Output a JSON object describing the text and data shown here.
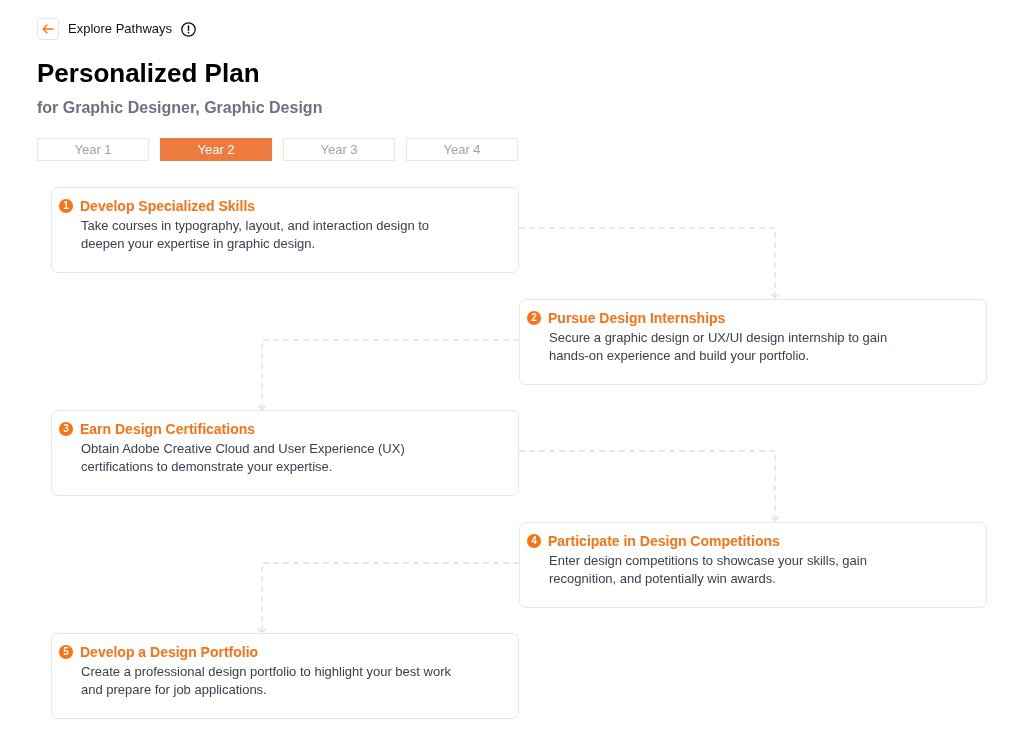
{
  "header": {
    "back_label": "Explore Pathways"
  },
  "title": "Personalized Plan",
  "subtitle": "for Graphic Designer, Graphic Design",
  "tabs": [
    {
      "label": "Year 1",
      "selected": false
    },
    {
      "label": "Year 2",
      "selected": true
    },
    {
      "label": "Year 3",
      "selected": false
    },
    {
      "label": "Year 4",
      "selected": false
    }
  ],
  "steps": [
    {
      "number": "1",
      "title": "Develop Specialized Skills",
      "description": "Take courses in typography, layout, and interaction design to deepen your expertise in graphic design."
    },
    {
      "number": "2",
      "title": "Pursue Design Internships",
      "description": "Secure a graphic design or UX/UI design internship to gain hands-on experience and build your portfolio."
    },
    {
      "number": "3",
      "title": "Earn Design Certifications",
      "description": "Obtain Adobe Creative Cloud and User Experience (UX) certifications to demonstrate your expertise."
    },
    {
      "number": "4",
      "title": "Participate in Design Competitions",
      "description": "Enter design competitions to showcase your skills, gain recognition, and potentially win awards."
    },
    {
      "number": "5",
      "title": "Develop a Design Portfolio",
      "description": "Create a professional design portfolio to highlight your best work and prepare for job applications."
    }
  ]
}
